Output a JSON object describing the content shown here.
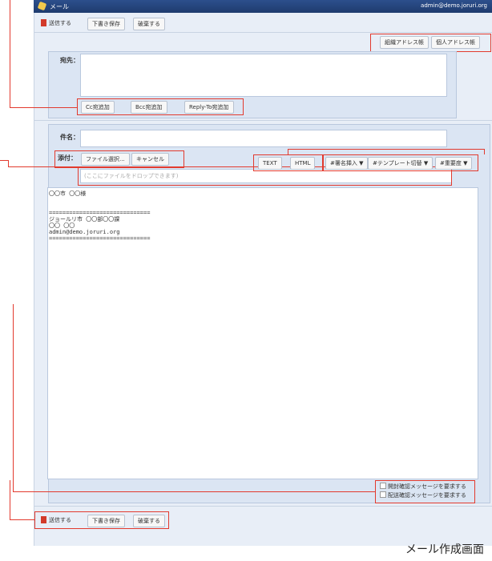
{
  "window": {
    "app_title": "メール",
    "user": "admin@demo.joruri.org"
  },
  "toolbar": {
    "send": "送信する",
    "save_draft": "下書き保存",
    "discard": "破棄する"
  },
  "addressbook": {
    "org": "組織アドレス帳",
    "personal": "個人アドレス帳"
  },
  "to": {
    "label": "宛先："
  },
  "add_buttons": {
    "cc": "Cc宛追加",
    "bcc": "Bcc宛追加",
    "reply_to": "Reply-To宛追加"
  },
  "subject": {
    "label": "件名："
  },
  "attach": {
    "label": "添付：",
    "select": "ファイル選択...",
    "cancel": "キャンセル",
    "drop_placeholder": "(ここにファイルをドロップできます)"
  },
  "format": {
    "text": "TEXT",
    "html": "HTML",
    "sig": "#署名挿入 ▼",
    "template": "#テンプレート切替 ▼",
    "importance": "#重要度 ▼"
  },
  "body": {
    "text": "〇〇市 〇〇様\n\n\n==============================\nジョールリ市 〇〇部〇〇課\n〇〇 〇〇\nadmin@demo.joruri.org\n=============================="
  },
  "options": {
    "read_receipt": "開封確認メッセージを要求する",
    "delivery_receipt": "配送確認メッセージを要求する"
  },
  "caption": "メール作成画面"
}
